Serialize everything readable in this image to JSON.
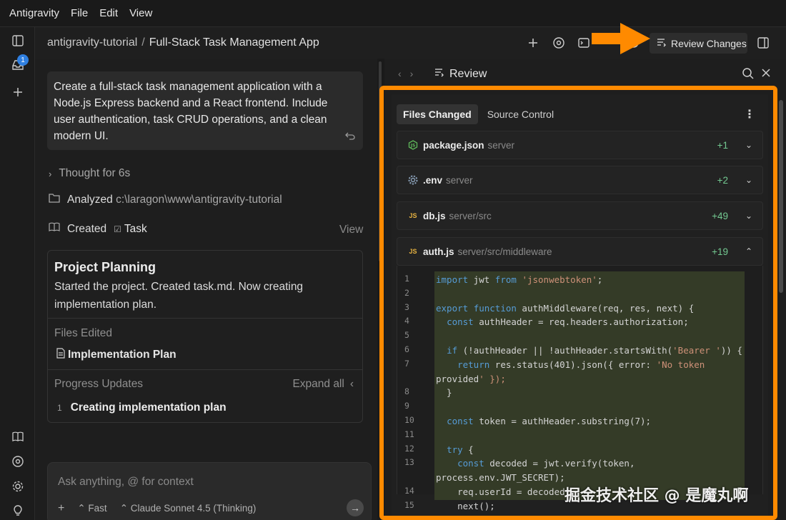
{
  "menubar": {
    "app": "Antigravity",
    "items": [
      "File",
      "Edit",
      "View"
    ]
  },
  "activity": {
    "inbox_badge": "1"
  },
  "header": {
    "breadcrumb_root": "antigravity-tutorial",
    "breadcrumb_sep": "/",
    "breadcrumb_current": "Full-Stack Task Management App",
    "review_button": "Review Changes"
  },
  "conversation": {
    "prompt": "Create a full-stack task management application with a Node.js Express backend and a React frontend. Include user authentication, task CRUD operations, and a clean modern UI.",
    "thought": "Thought for 6s",
    "analyzed_label": "Analyzed",
    "analyzed_path": "c:\\laragon\\www\\antigravity-tutorial",
    "created_label": "Created",
    "created_item": "Task",
    "view_link": "View",
    "plan": {
      "title": "Project Planning",
      "description": "Started the project. Created task.md. Now creating implementation plan.",
      "files_edited_label": "Files Edited",
      "file": "Implementation Plan",
      "progress_label": "Progress Updates",
      "expand_all": "Expand all",
      "progress_items": [
        {
          "num": "1",
          "text": "Creating implementation plan"
        }
      ]
    },
    "input": {
      "placeholder": "Ask anything, @ for context",
      "mode": "Fast",
      "model": "Claude Sonnet 4.5 (Thinking)"
    }
  },
  "review": {
    "title": "Review",
    "tabs": [
      "Files Changed",
      "Source Control"
    ],
    "files": [
      {
        "icon": "JS",
        "name": "package.json",
        "path": "server",
        "added": "+1",
        "expanded": false
      },
      {
        "icon": "gear",
        "name": ".env",
        "path": "server",
        "added": "+2",
        "expanded": false
      },
      {
        "icon": "JS",
        "name": "db.js",
        "path": "server/src",
        "added": "+49",
        "expanded": false
      },
      {
        "icon": "JS",
        "name": "auth.js",
        "path": "server/src/middleware",
        "added": "+19",
        "expanded": true
      }
    ],
    "code": [
      {
        "n": "1",
        "t": "import jwt from 'jsonwebtoken';"
      },
      {
        "n": "2",
        "t": ""
      },
      {
        "n": "3",
        "t": "export function authMiddleware(req, res, next) {"
      },
      {
        "n": "4",
        "t": "  const authHeader = req.headers.authorization;"
      },
      {
        "n": "5",
        "t": ""
      },
      {
        "n": "6",
        "t": "  if (!authHeader || !authHeader.startsWith('Bearer ')) {"
      },
      {
        "n": "7",
        "t": "    return res.status(401).json({ error: 'No token"
      },
      {
        "n": "",
        "t": "provided' });"
      },
      {
        "n": "8",
        "t": "  }"
      },
      {
        "n": "9",
        "t": ""
      },
      {
        "n": "10",
        "t": "  const token = authHeader.substring(7);"
      },
      {
        "n": "11",
        "t": ""
      },
      {
        "n": "12",
        "t": "  try {"
      },
      {
        "n": "13",
        "t": "    const decoded = jwt.verify(token,"
      },
      {
        "n": "",
        "t": "process.env.JWT_SECRET);"
      },
      {
        "n": "14",
        "t": "    req.userId = decoded."
      },
      {
        "n": "15",
        "t": "    next();"
      }
    ]
  },
  "watermark": "掘金技术社区 @ 是魔丸啊",
  "colors": {
    "highlight": "#ff8a00",
    "added": "#73c991",
    "accent": "#2f7fe0"
  }
}
